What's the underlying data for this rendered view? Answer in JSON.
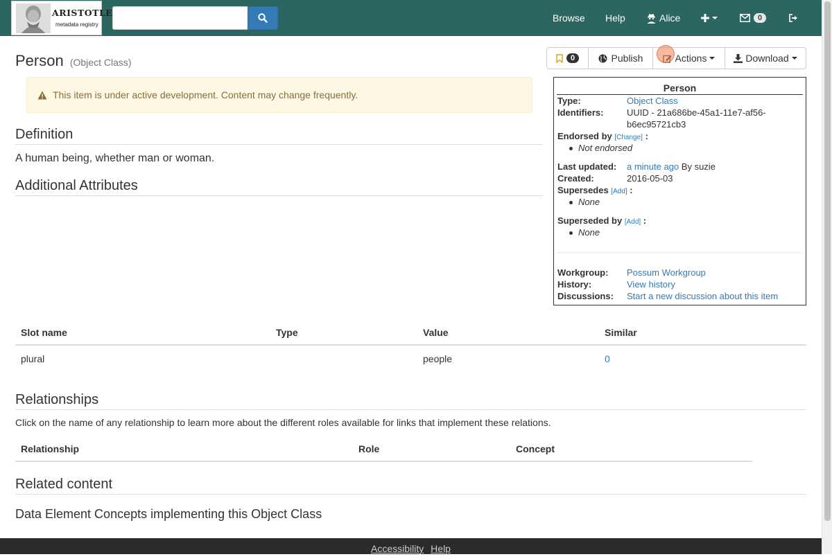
{
  "navbar": {
    "logo_text": "ARISTOTLE",
    "logo_subtext": "metadata registry",
    "search_placeholder": "",
    "browse": "Browse",
    "help": "Help",
    "user": "Alice",
    "inbox_count": "0"
  },
  "item": {
    "title": "Person",
    "type_label": "(Object Class)"
  },
  "actions": {
    "favourite_count": "0",
    "publish": "Publish",
    "actions": "Actions",
    "download": "Download"
  },
  "alert": {
    "text": "This item is under active development. Content may change frequently."
  },
  "definition": {
    "heading": "Definition",
    "text": "A human being, whether man or woman."
  },
  "additional_attributes": {
    "heading": "Additional Attributes"
  },
  "infobox": {
    "title": "Person",
    "type_label": "Type:",
    "type_value": "Object Class",
    "identifiers_label": "Identifiers:",
    "identifiers_line1": "UUID - 21a686be-45a1-11e7-af56-",
    "identifiers_line2": "b6ec95721cb3",
    "endorsed_label": "Endorsed by",
    "endorsed_link": "[Change]",
    "endorsed_value": "Not endorsed",
    "updated_label": "Last updated:",
    "updated_link": "a minute ago",
    "updated_by": "By suzie",
    "created_label": "Created:",
    "created_value": "2016-05-03",
    "supersedes_label": "Supersedes",
    "supersedes_link": "[Add]",
    "supersedes_value": "None",
    "superseded_label": "Superseded by",
    "superseded_link": "[Add]",
    "superseded_value": "None",
    "workgroup_label": "Workgroup:",
    "workgroup_value": "Possum Workgroup",
    "history_label": "History:",
    "history_value": "View history",
    "discussions_label": "Discussions:",
    "discussions_value": "Start a new discussion about this item"
  },
  "slots_table": {
    "headers": [
      "Slot name",
      "Type",
      "Value",
      "Similar"
    ],
    "rows": [
      [
        "plural",
        "",
        "people",
        "0"
      ]
    ]
  },
  "relationships": {
    "heading": "Relationships",
    "description": "Click on the name of any relationship to learn more about the different roles available for links that implement these relations.",
    "headers": [
      "Relationship",
      "Role",
      "Concept"
    ]
  },
  "related": {
    "heading": "Related content",
    "subheading": "Data Element Concepts implementing this Object Class"
  },
  "footer": {
    "accessibility": "Accessibility",
    "help": "Help"
  },
  "colors": {
    "navbar": "#2b6760",
    "link": "#337ab7",
    "alert_bg": "#fcf8e3",
    "alert_text": "#8a6d3b",
    "footer": "#2b2b2b"
  },
  "icons": [
    "search-icon",
    "user-secret-icon",
    "plus-icon",
    "envelope-icon",
    "sign-out-icon",
    "bookmark-icon",
    "globe-icon",
    "edit-icon",
    "download-icon",
    "warning-icon"
  ]
}
